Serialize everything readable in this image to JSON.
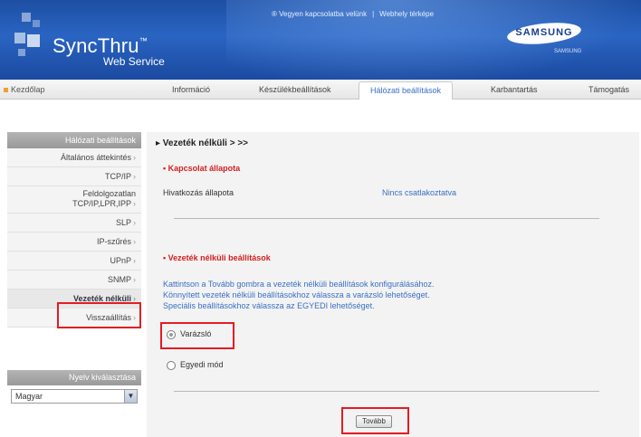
{
  "header": {
    "logo_text": "SyncThru",
    "logo_tm": "™",
    "logo_sub": "Web Service",
    "link_help": "® Vegyen kapcsolatba velünk",
    "link_sitemap": "Webhely térképe",
    "brand": "SAMSUNG",
    "brand_sub": "SAMSUNG"
  },
  "nav": {
    "home": "Kezdőlap",
    "tabs": [
      "Információ",
      "Készülékbeállítások",
      "Hálózati beállítások",
      "Karbantartás",
      "Támogatás"
    ],
    "active_tab": "Hálózati beállítások"
  },
  "sidebar": {
    "header": "Hálózati beállítások",
    "items": [
      {
        "label": "Általános áttekintés"
      },
      {
        "label": "TCP/IP"
      },
      {
        "label_line1": "Feldolgozatlan",
        "label_line2": "TCP/IP,LPR,IPP"
      },
      {
        "label": "SLP"
      },
      {
        "label": "IP-szűrés"
      },
      {
        "label": "UPnP"
      },
      {
        "label": "SNMP"
      },
      {
        "label": "Vezeték nélküli"
      },
      {
        "label": "Visszaállítás"
      }
    ],
    "arrow": "›",
    "active_item": "Vezeték nélküli",
    "lang_header": "Nyelv kiválasztása",
    "lang_value": "Magyar",
    "lang_arrow": "▼"
  },
  "content": {
    "breadcrumb": "▸ Vezeték nélküli > >>",
    "section1_title": "• Kapcsolat állapota",
    "status_label": "Hivatkozás állapota",
    "status_value": "Nincs csatlakoztatva",
    "section2_title": "• Vezeték nélküli beállítások",
    "desc_line1": "Kattintson a Tovább gombra a vezeték nélküli beállítások konfigurálásához.",
    "desc_line2": "Könnyített vezeték nélküli beállításokhoz válassza a varázsló lehetőséget.",
    "desc_line3": "Speciális beállításokhoz válassza az EGYEDI lehetőséget.",
    "radio_wizard": "Varázsló",
    "radio_custom": "Egyedi mód",
    "next_button": "Tovább"
  },
  "colors": {
    "header_blue": "#2a64c2",
    "accent_red": "#d32020",
    "link_blue": "#3a6fc4",
    "highlight_red": "#e41c24"
  }
}
